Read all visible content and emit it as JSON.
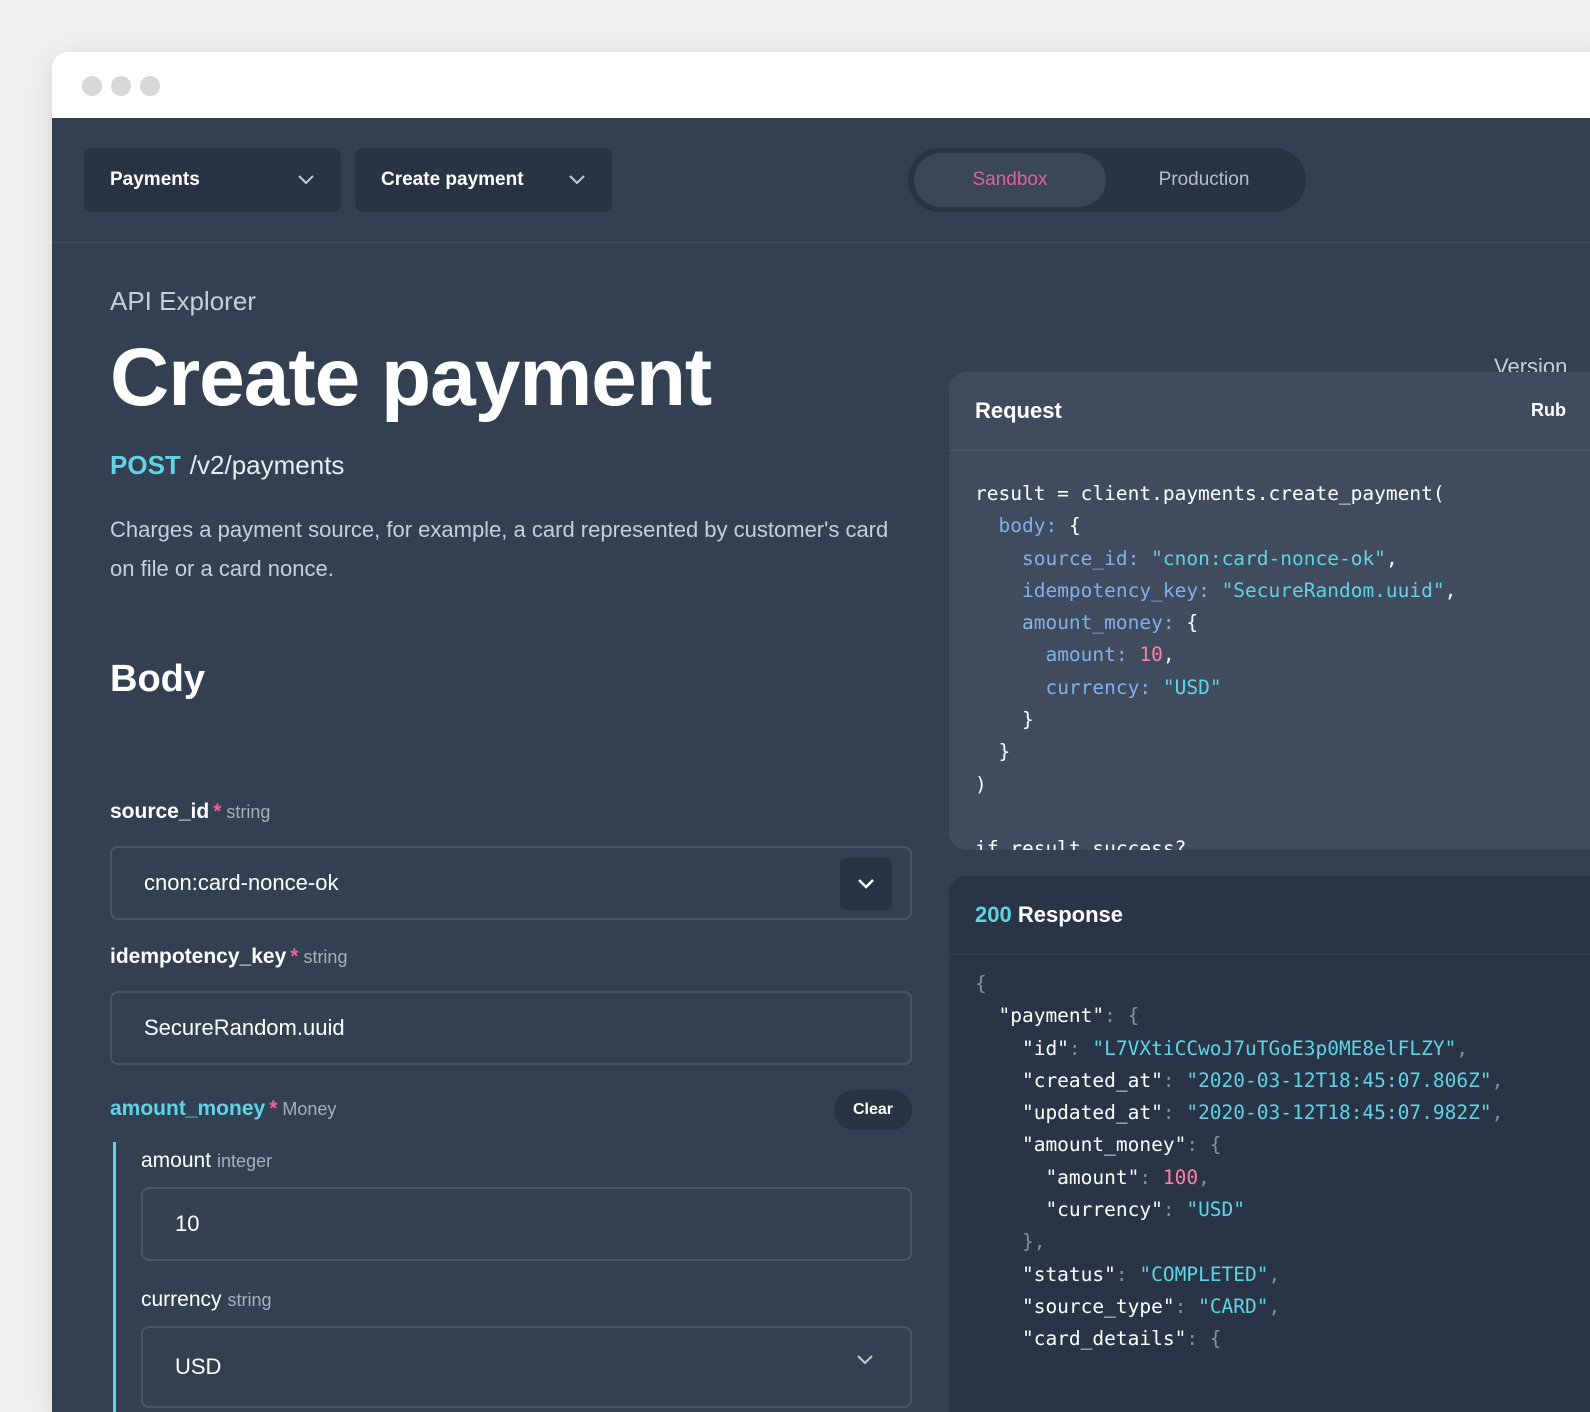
{
  "topbar": {
    "api_select": "Payments",
    "endpoint_select": "Create payment",
    "env": {
      "sandbox": "Sandbox",
      "production": "Production",
      "active": "sandbox"
    }
  },
  "page": {
    "eyebrow": "API Explorer",
    "title": "Create payment",
    "method": "POST",
    "path": "/v2/payments",
    "description": "Charges a payment source, for example, a card represented by customer's card on file or a card nonce.",
    "body_heading": "Body",
    "version_label": "Version"
  },
  "fields": {
    "source_id": {
      "name": "source_id",
      "required": "*",
      "type": "string",
      "value": "cnon:card-nonce-ok"
    },
    "idempotency_key": {
      "name": "idempotency_key",
      "required": "*",
      "type": "string",
      "value": "SecureRandom.uuid"
    },
    "amount_money": {
      "name": "amount_money",
      "required": "*",
      "type": "Money",
      "clear_label": "Clear",
      "amount": {
        "name": "amount",
        "type": "integer",
        "value": "10"
      },
      "currency": {
        "name": "currency",
        "type": "string",
        "value": "USD"
      }
    }
  },
  "request": {
    "title": "Request",
    "language": "Rub",
    "code_lines": [
      [
        [
          "result = client.payments.create_payment(",
          "plain"
        ]
      ],
      [
        [
          "  ",
          "plain"
        ],
        [
          "body",
          "key"
        ],
        [
          ":",
          "key"
        ],
        [
          " {",
          "plain"
        ]
      ],
      [
        [
          "    ",
          "plain"
        ],
        [
          "source_id",
          "key"
        ],
        [
          ": ",
          "key"
        ],
        [
          "\"cnon:card-nonce-ok\"",
          "str"
        ],
        [
          ",",
          "plain"
        ]
      ],
      [
        [
          "    ",
          "plain"
        ],
        [
          "idempotency_key",
          "key"
        ],
        [
          ": ",
          "key"
        ],
        [
          "\"SecureRandom.uuid\"",
          "str"
        ],
        [
          ",",
          "plain"
        ]
      ],
      [
        [
          "    ",
          "plain"
        ],
        [
          "amount_money",
          "key"
        ],
        [
          ": ",
          "key"
        ],
        [
          "{",
          "plain"
        ]
      ],
      [
        [
          "      ",
          "plain"
        ],
        [
          "amount",
          "key"
        ],
        [
          ": ",
          "key"
        ],
        [
          "10",
          "num"
        ],
        [
          ",",
          "plain"
        ]
      ],
      [
        [
          "      ",
          "plain"
        ],
        [
          "currency",
          "key"
        ],
        [
          ": ",
          "key"
        ],
        [
          "\"USD\"",
          "str"
        ]
      ],
      [
        [
          "    }",
          "plain"
        ]
      ],
      [
        [
          "  }",
          "plain"
        ]
      ],
      [
        [
          ")",
          "plain"
        ]
      ],
      [
        [
          "",
          "plain"
        ]
      ],
      [
        [
          "if result.success?",
          "plain"
        ]
      ]
    ]
  },
  "response": {
    "status_code": "200",
    "title": "Response",
    "code_lines": [
      [
        [
          "{",
          "pun"
        ]
      ],
      [
        [
          "  \"payment\"",
          "plain"
        ],
        [
          ": {",
          "pun"
        ]
      ],
      [
        [
          "    \"id\"",
          "plain"
        ],
        [
          ": ",
          "pun"
        ],
        [
          "\"L7VXtiCCwoJ7uTGoE3p0ME8elFLZY\"",
          "str"
        ],
        [
          ",",
          "pun"
        ]
      ],
      [
        [
          "    \"created_at\"",
          "plain"
        ],
        [
          ": ",
          "pun"
        ],
        [
          "\"2020-03-12T18:45:07.806Z\"",
          "str"
        ],
        [
          ",",
          "pun"
        ]
      ],
      [
        [
          "    \"updated_at\"",
          "plain"
        ],
        [
          ": ",
          "pun"
        ],
        [
          "\"2020-03-12T18:45:07.982Z\"",
          "str"
        ],
        [
          ",",
          "pun"
        ]
      ],
      [
        [
          "    \"amount_money\"",
          "plain"
        ],
        [
          ": {",
          "pun"
        ]
      ],
      [
        [
          "      \"amount\"",
          "plain"
        ],
        [
          ": ",
          "pun"
        ],
        [
          "100",
          "num"
        ],
        [
          ",",
          "pun"
        ]
      ],
      [
        [
          "      \"currency\"",
          "plain"
        ],
        [
          ": ",
          "pun"
        ],
        [
          "\"USD\"",
          "str"
        ]
      ],
      [
        [
          "    },",
          "pun"
        ]
      ],
      [
        [
          "    \"status\"",
          "plain"
        ],
        [
          ": ",
          "pun"
        ],
        [
          "\"COMPLETED\"",
          "str"
        ],
        [
          ",",
          "pun"
        ]
      ],
      [
        [
          "    \"source_type\"",
          "plain"
        ],
        [
          ": ",
          "pun"
        ],
        [
          "\"CARD\"",
          "str"
        ],
        [
          ",",
          "pun"
        ]
      ],
      [
        [
          "    \"card_details\"",
          "plain"
        ],
        [
          ": {",
          "pun"
        ]
      ]
    ]
  }
}
